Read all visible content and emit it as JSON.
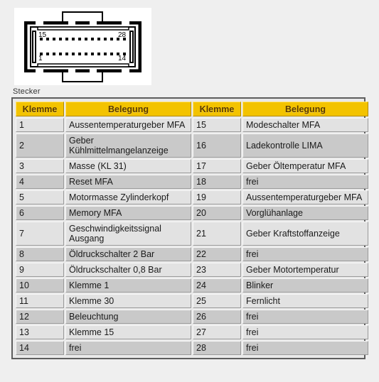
{
  "page": {
    "background_color": "#efefef",
    "caption": "Stecker"
  },
  "diagram": {
    "name": "connector-pinout-diagram",
    "background_color": "#ffffff",
    "outline_color": "#000000",
    "pin_rows": 2,
    "pins_per_row": 14,
    "labels": {
      "top_left": "15",
      "top_right": "28",
      "bottom_left": "1",
      "bottom_right": "14"
    }
  },
  "table": {
    "headers": [
      "Klemme",
      "Belegung",
      "Klemme",
      "Belegung"
    ],
    "header_bg": "#f3c300",
    "header_text_color": "#5a3a00",
    "row_light_bg": "#e2e2e2",
    "row_dark_bg": "#c9c9c9",
    "rows": [
      {
        "klemme_a": "1",
        "belegung_a": "Aussentemperaturgeber MFA",
        "klemme_b": "15",
        "belegung_b": "Modeschalter MFA"
      },
      {
        "klemme_a": "2",
        "belegung_a": "Geber Kühlmittelmangelanzeige",
        "klemme_b": "16",
        "belegung_b": "Ladekontrolle LIMA"
      },
      {
        "klemme_a": "3",
        "belegung_a": "Masse (KL 31)",
        "klemme_b": "17",
        "belegung_b": "Geber Öltemperatur MFA"
      },
      {
        "klemme_a": "4",
        "belegung_a": "Reset MFA",
        "klemme_b": "18",
        "belegung_b": "frei"
      },
      {
        "klemme_a": "5",
        "belegung_a": "Motormasse Zylinderkopf",
        "klemme_b": "19",
        "belegung_b": "Aussentemperaturgeber MFA"
      },
      {
        "klemme_a": "6",
        "belegung_a": "Memory MFA",
        "klemme_b": "20",
        "belegung_b": "Vorglühanlage"
      },
      {
        "klemme_a": "7",
        "belegung_a": "Geschwindigkeitssignal Ausgang",
        "klemme_b": "21",
        "belegung_b": "Geber Kraftstoffanzeige"
      },
      {
        "klemme_a": "8",
        "belegung_a": "Öldruckschalter 2 Bar",
        "klemme_b": "22",
        "belegung_b": "frei"
      },
      {
        "klemme_a": "9",
        "belegung_a": "Öldruckschalter 0,8 Bar",
        "klemme_b": "23",
        "belegung_b": "Geber Motortemperatur"
      },
      {
        "klemme_a": "10",
        "belegung_a": "Klemme 1",
        "klemme_b": "24",
        "belegung_b": "Blinker"
      },
      {
        "klemme_a": "11",
        "belegung_a": "Klemme 30",
        "klemme_b": "25",
        "belegung_b": "Fernlicht"
      },
      {
        "klemme_a": "12",
        "belegung_a": "Beleuchtung",
        "klemme_b": "26",
        "belegung_b": "frei"
      },
      {
        "klemme_a": "13",
        "belegung_a": "Klemme 15",
        "klemme_b": "27",
        "belegung_b": "frei"
      },
      {
        "klemme_a": "14",
        "belegung_a": "frei",
        "klemme_b": "28",
        "belegung_b": "frei"
      }
    ]
  }
}
